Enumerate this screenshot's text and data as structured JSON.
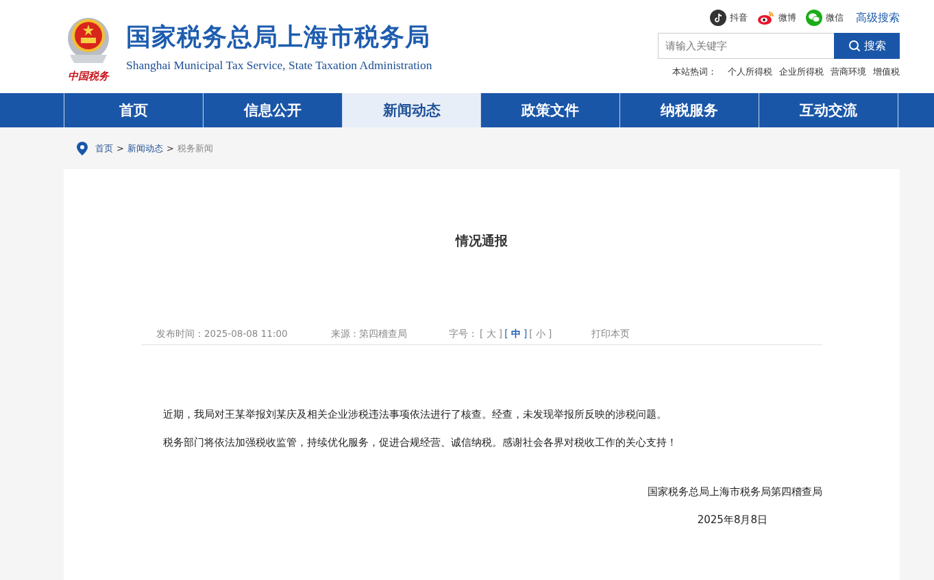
{
  "header": {
    "emblem_caption": "中国税务",
    "title": "国家税务总局上海市税务局",
    "subtitle": "Shanghai Municipal Tax Service, State Taxation Administration",
    "social": [
      {
        "kind": "douyin",
        "label": "抖音"
      },
      {
        "kind": "weibo",
        "label": "微博"
      },
      {
        "kind": "wechat",
        "label": "微信"
      }
    ],
    "advanced_search": "高级搜索",
    "search": {
      "placeholder": "请输入关键字",
      "button": "搜索"
    },
    "hot_words_label": "本站热词：",
    "hot_words": [
      "个人所得税",
      "企业所得税",
      "营商环境",
      "增值税"
    ]
  },
  "nav": [
    {
      "label": "首页",
      "selected": false
    },
    {
      "label": "信息公开",
      "selected": false
    },
    {
      "label": "新闻动态",
      "selected": true
    },
    {
      "label": "政策文件",
      "selected": false
    },
    {
      "label": "纳税服务",
      "selected": false
    },
    {
      "label": "互动交流",
      "selected": false
    }
  ],
  "breadcrumb": [
    {
      "label": "首页",
      "current": false
    },
    {
      "label": "新闻动态",
      "current": false
    },
    {
      "label": "税务新闻",
      "current": true
    }
  ],
  "breadcrumb_separator": ">",
  "article": {
    "title": "情况通报",
    "published": "发布时间：2025-08-08 11:00",
    "source": "来源 : 第四稽查局",
    "font_size_label": "字号：",
    "font_sizes": [
      {
        "open": "[",
        "label": "大",
        "close": "]",
        "selected": false
      },
      {
        "open": "[",
        "label": "中",
        "close": "]",
        "selected": true
      },
      {
        "open": "[",
        "label": "小",
        "close": "]",
        "selected": false
      }
    ],
    "print": "打印本页",
    "paragraphs": [
      "近期，我局对王某举报刘某庆及相关企业涉税违法事项依法进行了核查。经查，未发现举报所反映的涉税问题。",
      "税务部门将依法加强税收监管，持续优化服务，促进合规经营、诚信纳税。感谢社会各界对税收工作的关心支持！"
    ],
    "signature": "国家税务总局上海市税务局第四稽查局",
    "date": "2025年8月8日"
  }
}
